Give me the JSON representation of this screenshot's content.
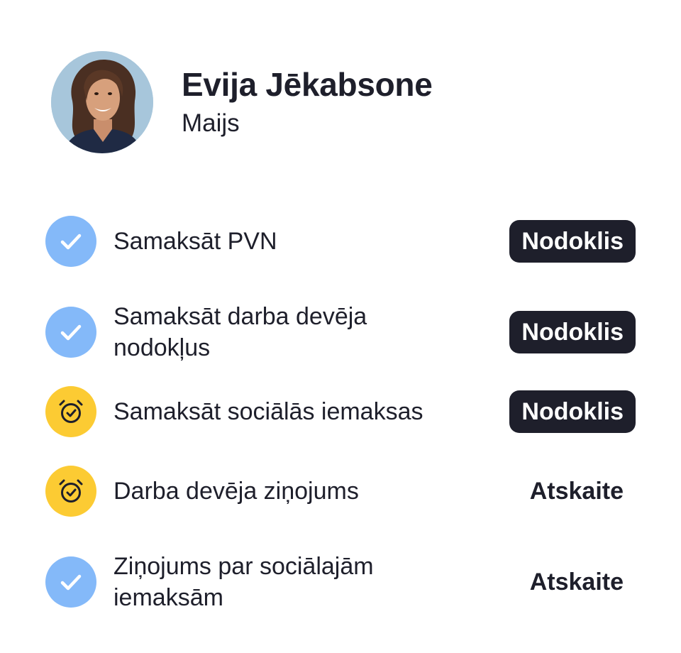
{
  "profile": {
    "name": "Evija Jēkabsone",
    "month": "Maijs",
    "avatar_icon": "person-portrait-icon"
  },
  "colors": {
    "done": "#84b9f9",
    "pending": "#fccb33",
    "badge_dark": "#1e1f2b",
    "text": "#1e1f2b"
  },
  "tasks": [
    {
      "label": "Samaksāt PVN",
      "status": "done",
      "status_icon": "check-icon",
      "tag": "Nodoklis",
      "tag_style": "dark"
    },
    {
      "label": "Samaksāt darba devēja nodokļus",
      "status": "done",
      "status_icon": "check-icon",
      "tag": "Nodoklis",
      "tag_style": "dark"
    },
    {
      "label": "Samaksāt sociālās iemaksas",
      "status": "pending",
      "status_icon": "alarm-clock-check-icon",
      "tag": "Nodoklis",
      "tag_style": "dark"
    },
    {
      "label": "Darba devēja ziņojums",
      "status": "pending",
      "status_icon": "alarm-clock-check-icon",
      "tag": "Atskaite",
      "tag_style": "plain"
    },
    {
      "label": "Ziņojums par sociālajām iemaksām",
      "status": "done",
      "status_icon": "check-icon",
      "tag": "Atskaite",
      "tag_style": "plain"
    }
  ]
}
